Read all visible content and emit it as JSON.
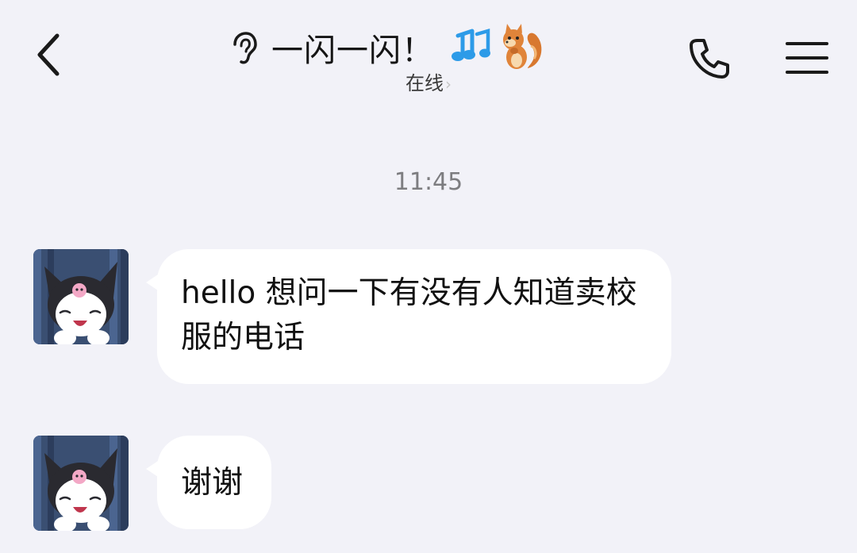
{
  "header": {
    "title": "一闪一闪！",
    "status": "在线",
    "status_chevron": "›",
    "icons": {
      "back": "chevron-left-icon",
      "voice": "ear-icon",
      "title_emoji": [
        "musical-notes-icon",
        "squirrel-icon"
      ],
      "call": "phone-icon",
      "menu": "menu-icon"
    }
  },
  "conversation": {
    "timestamp": "11:45",
    "messages": [
      {
        "sender_avatar": "kuromi-avatar",
        "text": "hello 想问一下有没有人知道卖校服的电话"
      },
      {
        "sender_avatar": "kuromi-avatar",
        "text": "谢谢"
      }
    ]
  },
  "colors": {
    "background": "#f2f2f8",
    "bubble": "#ffffff",
    "text": "#111111",
    "timestamp": "#7d7d80",
    "emoji_notes": "#2d9be8"
  }
}
